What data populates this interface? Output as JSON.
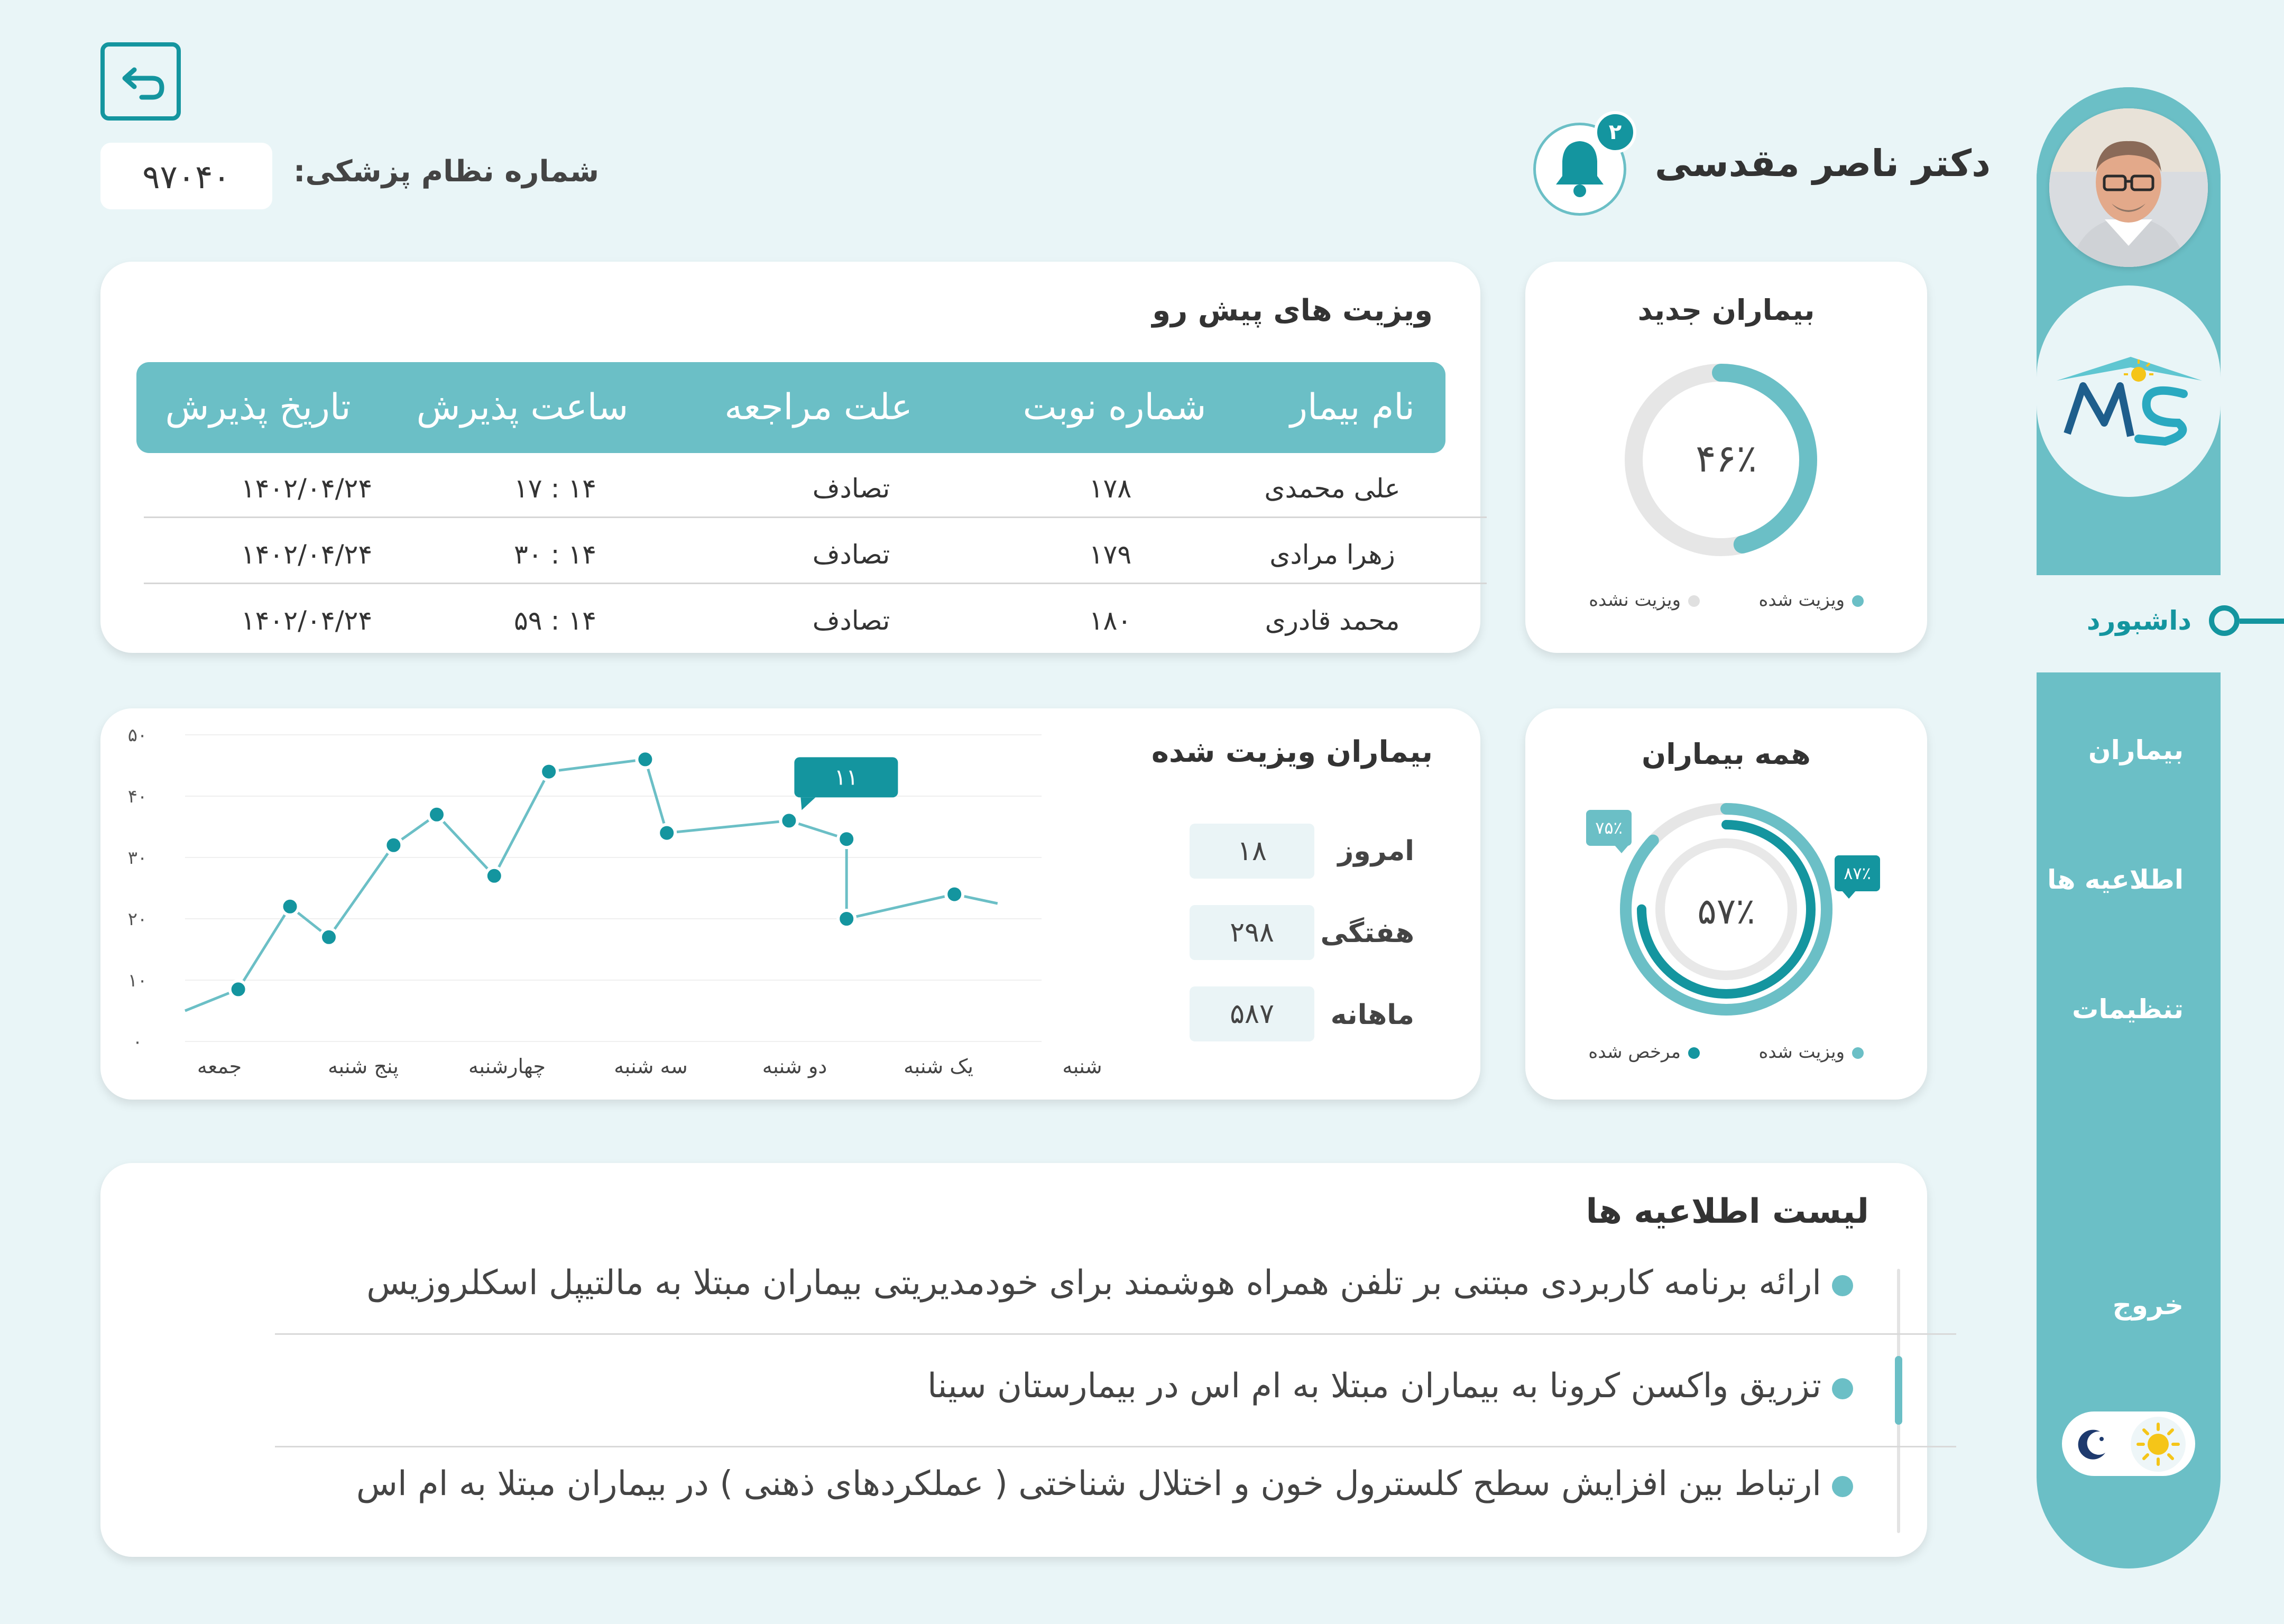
{
  "header": {
    "doctor_name": "دکتر ناصر مقدسی",
    "license_label": "شماره نظام پزشکی:",
    "license_number": "۹۷۰۴۰",
    "notification_count": "۲"
  },
  "sidebar": {
    "items": [
      {
        "label": "داشبورد"
      },
      {
        "label": "بیماران"
      },
      {
        "label": "اطلاعیه ها"
      },
      {
        "label": "تنظیمات"
      },
      {
        "label": "خروج"
      }
    ],
    "logo_text": "MS"
  },
  "upcoming": {
    "title": "ویزیت های پیش رو",
    "columns": [
      "نام بیمار",
      "شماره نوبت",
      "علت مراجعه",
      "ساعت پذیرش",
      "تاریخ پذیرش"
    ],
    "rows": [
      [
        "علی محمدی",
        "۱۷۸",
        "تصادف",
        "۱۴ : ۱۷",
        "۱۴۰۲/۰۴/۲۴"
      ],
      [
        "زهرا مرادی",
        "۱۷۹",
        "تصادف",
        "۱۴ : ۳۰",
        "۱۴۰۲/۰۴/۲۴"
      ],
      [
        "محمد قادری",
        "۱۸۰",
        "تصادف",
        "۱۴ : ۵۹",
        "۱۴۰۲/۰۴/۲۴"
      ]
    ]
  },
  "new_patients": {
    "title": "بیماران جدید",
    "percent_label": "۴۶٪",
    "percent_value": 46,
    "legend": [
      "ویزیت شده",
      "ویزیت نشده"
    ],
    "colors": {
      "visited": "#6bbfc6",
      "not_visited": "#e6e6e6"
    }
  },
  "visited_patients": {
    "title": "بیماران ویزیت شده",
    "stats": [
      {
        "label": "امروز",
        "value": "۱۸"
      },
      {
        "label": "هفتگی",
        "value": "۲۹۸"
      },
      {
        "label": "ماهانه",
        "value": "۵۸۷"
      }
    ]
  },
  "all_patients": {
    "title": "همه بیماران",
    "center_label": "۵۷٪",
    "center_value": 57,
    "inner_badge": "۷۵٪",
    "inner_value": 75,
    "outer_badge": "۸۷٪",
    "outer_value": 87,
    "legend": [
      "ویزیت شده",
      "مرخص شده"
    ],
    "colors": {
      "visited": "#6bbfc6",
      "discharged": "#14959f"
    }
  },
  "chart_data": {
    "type": "line",
    "categories": [
      "جمعه",
      "پنج شنبه",
      "چهارشنبه",
      "سه شنبه",
      "دو شنبه",
      "یک شنبه",
      "شنبه"
    ],
    "y_ticks": [
      "۰",
      "۱۰",
      "۲۰",
      "۳۰",
      "۴۰",
      "۵۰"
    ],
    "ylim": [
      0,
      50
    ],
    "points": [
      {
        "x": 0.0,
        "y": 5
      },
      {
        "x": 0.37,
        "y": 8.5
      },
      {
        "x": 0.73,
        "y": 22
      },
      {
        "x": 1.0,
        "y": 17
      },
      {
        "x": 1.45,
        "y": 32
      },
      {
        "x": 1.75,
        "y": 37
      },
      {
        "x": 2.15,
        "y": 27
      },
      {
        "x": 2.53,
        "y": 44
      },
      {
        "x": 3.2,
        "y": 46
      },
      {
        "x": 3.35,
        "y": 34
      },
      {
        "x": 4.2,
        "y": 36
      },
      {
        "x": 4.6,
        "y": 33
      },
      {
        "x": 4.6,
        "y": 20
      },
      {
        "x": 5.35,
        "y": 24
      },
      {
        "x": 5.65,
        "y": 22.5
      }
    ],
    "marked_points": [
      1,
      2,
      3,
      4,
      5,
      6,
      7,
      8,
      9,
      10,
      11,
      12,
      13
    ],
    "tooltip": {
      "label": "۱۱",
      "point_index": 10
    },
    "color": "#6bbfc6",
    "marker_color": "#14959f"
  },
  "notices": {
    "title": "لیست اطلاعیه ها",
    "items": [
      "ارائه برنامه کاربردی مبتنی بر تلفن همراه هوشمند برای خودمدیریتی بیماران مبتلا به مالتیپل اسکلروزیس",
      "تزریق واکسن کرونا به بیماران مبتلا به ام اس در بیمارستان سینا",
      "ارتباط بین افزایش سطح کلسترول خون و اختلال شناختی ( عملکردهای ذهنی ) در بیماران مبتلا به ام اس"
    ]
  }
}
